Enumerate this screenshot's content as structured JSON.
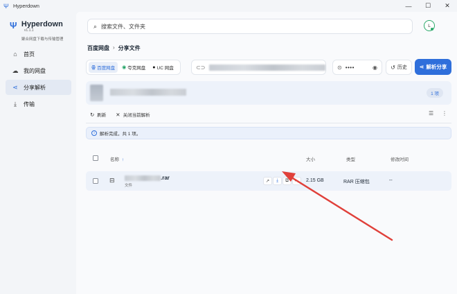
{
  "window": {
    "title": "Hyperdown",
    "icons": {
      "app": "hyperdown-logo-icon",
      "minimize": "minimize-icon",
      "maximize": "maximize-icon",
      "close": "close-icon"
    }
  },
  "sidebar": {
    "brand": {
      "name": "Hyperdown",
      "version": "v1.1.1",
      "subtitle": "聚合网盘下载与传输管理"
    },
    "items": [
      {
        "label": "首页",
        "icon": "home-icon",
        "active": false
      },
      {
        "label": "我的网盘",
        "icon": "cloud-icon",
        "active": false
      },
      {
        "label": "分享解析",
        "icon": "share-icon",
        "active": true
      },
      {
        "label": "传输",
        "icon": "download-icon",
        "active": false
      }
    ]
  },
  "search": {
    "placeholder": "搜索文件、文件夹",
    "icon": "search-icon"
  },
  "user": {
    "avatar_letter": "L",
    "status_color": "#2aa869"
  },
  "breadcrumb": {
    "items": [
      "百度网盘",
      "分享文件"
    ],
    "separator": "›"
  },
  "sources": [
    {
      "label": "百度网盘",
      "icon": "baidu-icon",
      "active": true
    },
    {
      "label": "夸克网盘",
      "icon": "quark-icon",
      "active": false
    },
    {
      "label": "UC 网盘",
      "icon": "uc-icon",
      "active": false
    }
  ],
  "share_link": {
    "icon": "link-icon",
    "value_redacted": true
  },
  "password": {
    "icon": "key-icon",
    "value": "••••",
    "eye_icon": "eye-icon"
  },
  "history_button": {
    "label": "历史",
    "icon": "history-icon"
  },
  "parse_button": {
    "label": "解析分享",
    "icon": "share-icon"
  },
  "share_card": {
    "count_badge": "1 项",
    "title_redacted": true
  },
  "toolbar": {
    "refresh": "刷新",
    "close_current": "关闭当前解析",
    "filter_icon": "filter-icon",
    "more_icon": "more-icon"
  },
  "notice": {
    "text": "解析完成，共 1 项。",
    "icon": "info-icon"
  },
  "table": {
    "columns": {
      "name": "名称",
      "sort_arrow": "↑",
      "size": "大小",
      "type": "类型",
      "modified": "修改时间"
    },
    "rows": [
      {
        "name_suffix": ".rar",
        "subtitle": "文件",
        "size": "2.15 GB",
        "type": "RAR 压缩包",
        "modified": "--"
      }
    ],
    "row_action_icons": [
      "open-external-icon",
      "download-icon",
      "copy-link-icon",
      "more-icon"
    ]
  },
  "colors": {
    "accent": "#2f6fdb",
    "annotation_arrow": "#e0403a",
    "selected_bg": "#edf2fa"
  }
}
